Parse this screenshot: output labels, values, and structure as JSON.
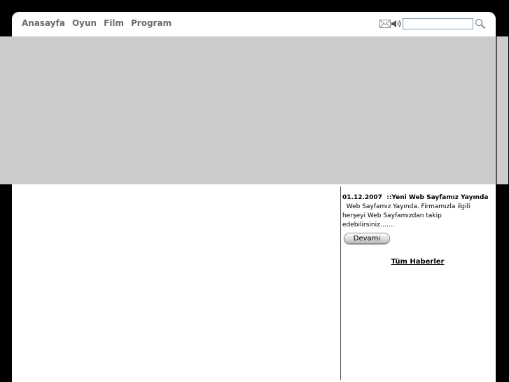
{
  "nav": {
    "items": [
      {
        "label": "Anasayfa"
      },
      {
        "label": "Oyun"
      },
      {
        "label": "Film"
      },
      {
        "label": "Program"
      }
    ]
  },
  "tools": {
    "icons": [
      "mail-icon",
      "speaker-icon",
      "search-icon"
    ],
    "search_value": ""
  },
  "news": {
    "date": "01.12.2007",
    "separator": "::",
    "title": "Yeni Web Sayfamız Yayında",
    "body": "Web Sayfamız Yayında. Firmamızla ilgili herşeyi Web Sayfamızdan takip edebilirsiniz…….",
    "more_label": "Devamı",
    "all_label": "Tüm Haberler"
  },
  "colors": {
    "background": "#000000",
    "banner": "#cccccc",
    "nav_text": "#6b6b6b"
  }
}
